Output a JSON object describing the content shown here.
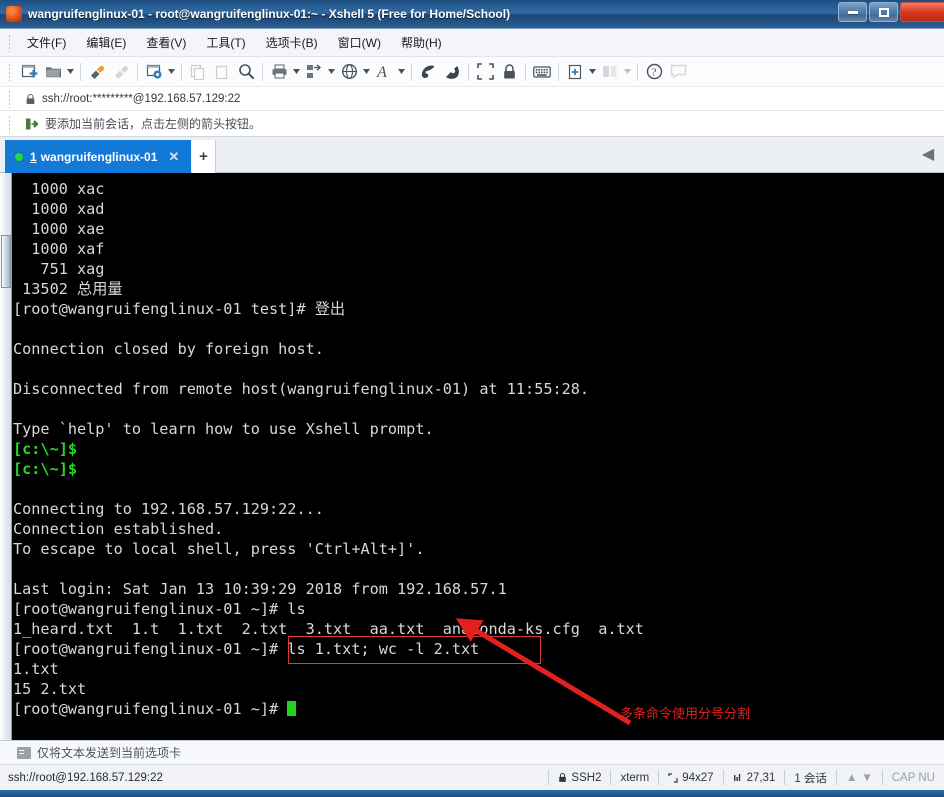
{
  "window": {
    "title": "wangruifenglinux-01 - root@wangruifenglinux-01:~ - Xshell 5 (Free for Home/School)",
    "minimize_label": "–",
    "maximize_label": "□",
    "close_label": "×"
  },
  "menubar": {
    "items": [
      {
        "label": "文件(F)",
        "name": "menu-file"
      },
      {
        "label": "编辑(E)",
        "name": "menu-edit"
      },
      {
        "label": "查看(V)",
        "name": "menu-view"
      },
      {
        "label": "工具(T)",
        "name": "menu-tools"
      },
      {
        "label": "选项卡(B)",
        "name": "menu-tabs"
      },
      {
        "label": "窗口(W)",
        "name": "menu-window"
      },
      {
        "label": "帮助(H)",
        "name": "menu-help"
      }
    ]
  },
  "toolbar": {
    "icons": [
      "new-session-icon",
      "open-folder-icon",
      "reconnect-icon",
      "disconnect-icon",
      "session-properties-icon",
      "copy-icon",
      "paste-icon",
      "find-icon",
      "print-icon",
      "file-transfer-icon",
      "web-browser-icon",
      "font-icon",
      "script-run-icon",
      "script-stop-icon",
      "fullscreen-icon",
      "lock-icon",
      "keyboard-icon",
      "add-layout-icon",
      "arrange-icon",
      "help-icon",
      "comment-icon"
    ]
  },
  "urlbar": {
    "lock_icon": "lock-icon",
    "url": "ssh://root:*********@192.168.57.129:22"
  },
  "hintbar": {
    "icon": "add-to-favorites-icon",
    "text": "要添加当前会话，点击左侧的箭头按钮。"
  },
  "tabbar": {
    "tab_index": "1",
    "tab_title": "wangruifenglinux-01",
    "close_label": "✕",
    "new_tab_label": "+",
    "nav_label": "◀"
  },
  "terminal": {
    "lines": [
      {
        "text": "  1000 xac",
        "color": "default"
      },
      {
        "text": "  1000 xad",
        "color": "default"
      },
      {
        "text": "  1000 xae",
        "color": "default"
      },
      {
        "text": "  1000 xaf",
        "color": "default"
      },
      {
        "text": "   751 xag",
        "color": "default"
      },
      {
        "text": " 13502 总用量",
        "color": "default"
      },
      {
        "text": "[root@wangruifenglinux-01 test]# 登出",
        "color": "default"
      },
      {
        "text": "",
        "color": "default"
      },
      {
        "text": "Connection closed by foreign host.",
        "color": "default"
      },
      {
        "text": "",
        "color": "default"
      },
      {
        "text": "Disconnected from remote host(wangruifenglinux-01) at 11:55:28.",
        "color": "default"
      },
      {
        "text": "",
        "color": "default"
      },
      {
        "text": "Type `help' to learn how to use Xshell prompt.",
        "color": "default"
      },
      {
        "text": "[c:\\~]$",
        "color": "green"
      },
      {
        "text": "[c:\\~]$",
        "color": "green"
      },
      {
        "text": "",
        "color": "default"
      },
      {
        "text": "Connecting to 192.168.57.129:22...",
        "color": "default"
      },
      {
        "text": "Connection established.",
        "color": "default"
      },
      {
        "text": "To escape to local shell, press 'Ctrl+Alt+]'.",
        "color": "default"
      },
      {
        "text": "",
        "color": "default"
      },
      {
        "text": "Last login: Sat Jan 13 10:39:29 2018 from 192.168.57.1",
        "color": "default"
      },
      {
        "text": "[root@wangruifenglinux-01 ~]# ls",
        "color": "default"
      },
      {
        "text": "1_heard.txt  1.t  1.txt  2.txt  3.txt  aa.txt  anaconda-ks.cfg  a.txt",
        "color": "default"
      },
      {
        "text": "[root@wangruifenglinux-01 ~]# ls 1.txt; wc -l 2.txt",
        "color": "default"
      },
      {
        "text": "1.txt",
        "color": "default"
      },
      {
        "text": "15 2.txt",
        "color": "default"
      },
      {
        "text": "[root@wangruifenglinux-01 ~]# ",
        "color": "default",
        "cursor": true
      }
    ]
  },
  "annotation": {
    "text": "多条命令使用分号分割",
    "color": "#e02020"
  },
  "sendbar": {
    "icon": "send-to-tab-icon",
    "text": "仅将文本发送到当前选项卡"
  },
  "statusbar": {
    "address": "ssh://root@192.168.57.129:22",
    "protocol_icon": "lock-icon",
    "protocol": "SSH2",
    "terminal_type": "xterm",
    "size_icon": "screen-size-icon",
    "size": "94x27",
    "cursor_icon": "cursor-position-icon",
    "cursor_pos": "27,31",
    "sessions": "1 会话",
    "up_arrow": "▲",
    "down_arrow": "▼",
    "caps": "CAP",
    "num": "NU"
  }
}
